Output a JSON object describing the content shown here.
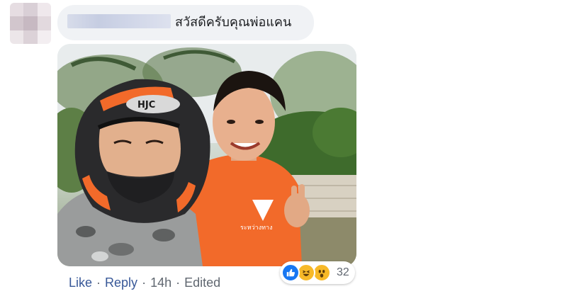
{
  "comment": {
    "text": "สวัสดีครับคุณพ่อแคน"
  },
  "photo": {
    "helmet_brand": "HJC",
    "shirt_logo_text": "ระหว่างทาง"
  },
  "actions": {
    "like_label": "Like",
    "reply_label": "Reply",
    "separator": "·",
    "time": "14h",
    "edited_label": "Edited"
  },
  "reactions": {
    "icons": [
      "like-icon",
      "haha-icon",
      "wow-icon"
    ],
    "count": "32",
    "colors": {
      "like": "#1877f2",
      "emoji": "#f7b928"
    }
  },
  "colors": {
    "bubble_bg": "#f0f2f5",
    "link": "#385898",
    "meta": "#606770",
    "text": "#1c1e21"
  }
}
